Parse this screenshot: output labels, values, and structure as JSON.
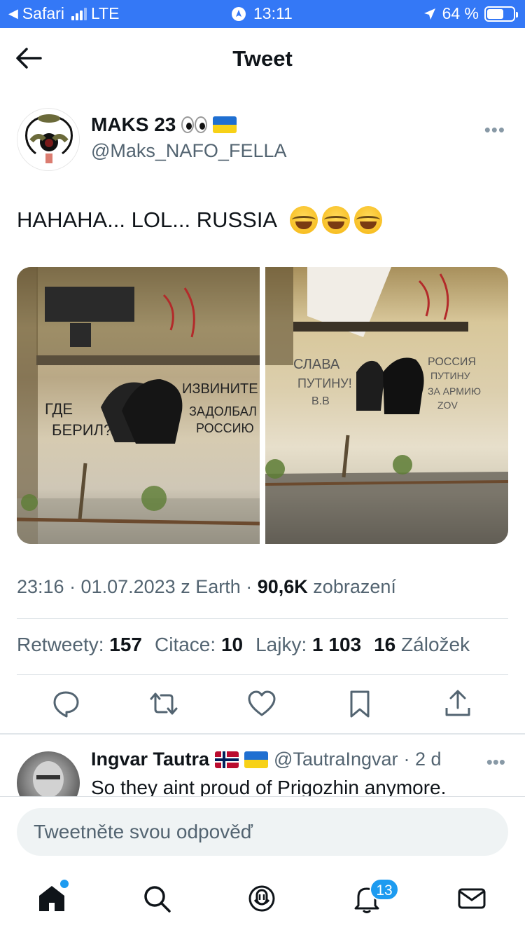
{
  "status_bar": {
    "carrier": "Safari",
    "network": "LTE",
    "time": "13:11",
    "battery": "64 %",
    "battery_level": 0.64
  },
  "header": {
    "title": "Tweet"
  },
  "tweet": {
    "author_name": "MAKS 23",
    "author_handle": "@Maks_NAFO_FELLA",
    "text": "HAHAHA... LOL... RUSSIA",
    "emoji_count": 3,
    "meta_time": "23:16 · 01.07.2023 z Earth · ",
    "views_count": "90,6K",
    "views_label": " zobrazení",
    "retweets_label": "Retweety:",
    "retweets": "157",
    "quotes_label": "Citace:",
    "quotes": "10",
    "likes_label": "Lajky:",
    "likes": "1 103",
    "bookmarks": "16",
    "bookmarks_label": "Záložek"
  },
  "reply": {
    "name": "Ingvar Tautra",
    "handle": "@TautraIngvar",
    "time": "· 2 d",
    "text": "So they aint proud of Prigozhin anymore."
  },
  "composer": {
    "placeholder": "Tweetněte svou odpověď"
  },
  "tabbar": {
    "notifications_badge": "13"
  },
  "colors": {
    "status_bar": "#3478f6",
    "accent": "#1d9bf0"
  }
}
